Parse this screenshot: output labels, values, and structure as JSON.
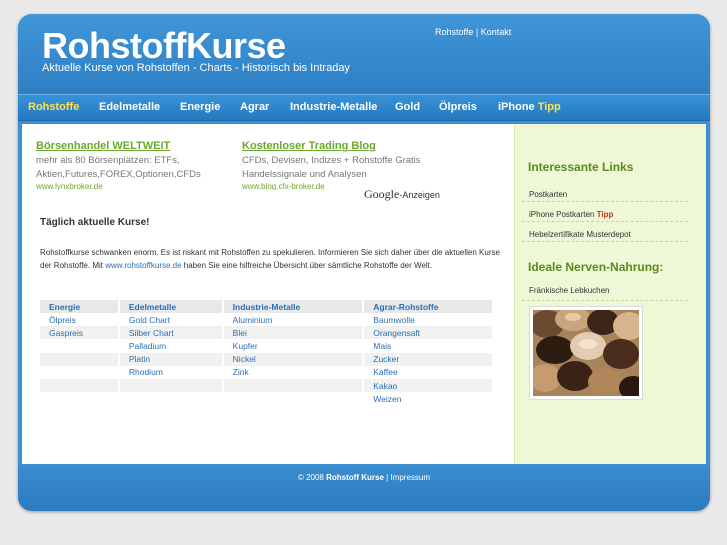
{
  "header": {
    "logo": "RohstoffKurse",
    "tagline": "Aktuelle Kurse von Rohstoffen - Charts - Historisch bis Intraday",
    "toplinks": [
      "Rohstoffe",
      "Kontakt"
    ]
  },
  "nav": {
    "items": [
      "Rohstoffe",
      "Edelmetalle",
      "Energie",
      "Agrar",
      "Industrie-Metalle",
      "Gold",
      "Ölpreis",
      "iPhone"
    ],
    "tipp": "Tipp",
    "active_index": 0
  },
  "ads": [
    {
      "title": "Börsenhandel WELTWEIT",
      "lines": [
        "mehr als 80 Börsenplätzen: ETFs,",
        "Aktien,Futures,FOREX,Optionen,CFDs"
      ],
      "url": "www.lynxbroker.de"
    },
    {
      "title": "Kostenloser Trading Blog",
      "lines": [
        "CFDs, Devisen, Indizes + Rohstoffe Gratis",
        "Handelssignale und Analysen"
      ],
      "url": "www.blog.cfx-broker.de"
    }
  ],
  "google_ads": {
    "brand": "Google",
    "suffix": "-Anzeigen"
  },
  "main": {
    "heading": "Täglich aktuelle Kurse!",
    "intro_before": "Rohstoffkurse schwanken enorm. Es ist riskant mit Rohstoffen zu spekulieren. Informieren Sie sich daher über die aktuellen Kurse der Rohstoffe. Mit ",
    "intro_link": "www.rohstoffkurse.de",
    "intro_after": " haben Sie eine hilfreiche Übersicht über sämtliche Rohstoffe der Welt."
  },
  "table": {
    "headers": [
      "Energie",
      "Edelmetalle",
      "Industrie-Metalle",
      "Agrar-Rohstoffe"
    ],
    "rows": [
      [
        "Ölpreis",
        "Gold Chart",
        "Aluminium",
        "Baumwolle"
      ],
      [
        "Gaspreis",
        "Silber Chart",
        "Blei",
        "Orangensaft"
      ],
      [
        "",
        "Palladium",
        "Kupfer",
        "Mais"
      ],
      [
        "",
        "Platin",
        "Nickel",
        "Zucker"
      ],
      [
        "",
        "Rhodium",
        "Zink",
        "Kaffee"
      ],
      [
        "",
        "",
        "",
        "Kakao"
      ],
      [
        "",
        "",
        "",
        "Weizen"
      ]
    ]
  },
  "sidebar": {
    "links_heading": "Interessante Links",
    "links": [
      {
        "label": "Postkarten",
        "tipp": ""
      },
      {
        "label": "iPhone Postkarten",
        "tipp": "Tipp"
      },
      {
        "label": "Hebelzertifikate Musterdepot",
        "tipp": ""
      }
    ],
    "food_heading": "Ideale Nerven-Nahrung:",
    "food_item": "Fränkische Lebkuchen"
  },
  "footer": {
    "copyright": "© 2008",
    "site": "Rohstoff Kurse",
    "separator": "|",
    "impressum": "Impressum"
  },
  "colors": {
    "blue": "#3d8fd0",
    "nav_active": "#ffe04a",
    "ad_green": "#6aaa2a",
    "sidebar_green": "#5c8a1f",
    "sidebar_bg": "#eef7d6",
    "link_blue": "#2a6fb5",
    "tipp_red": "#d32b1d"
  }
}
